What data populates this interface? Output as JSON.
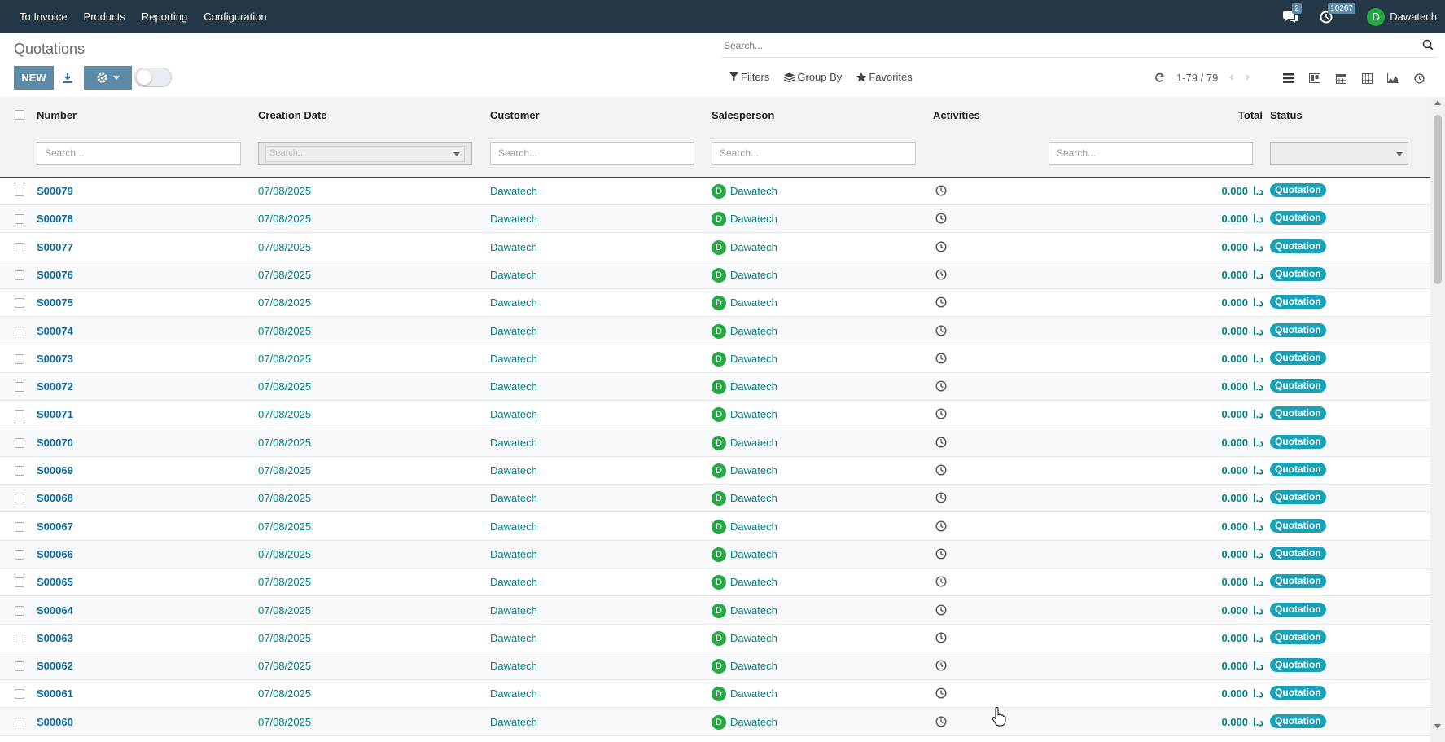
{
  "topbar": {
    "menu": [
      "To Invoice",
      "Products",
      "Reporting",
      "Configuration"
    ],
    "messages_count": "2",
    "activities_count": "10267",
    "user_initial": "D",
    "user_name": "Dawatech"
  },
  "control_panel": {
    "title": "Quotations",
    "new_label": "NEW",
    "search_placeholder": "Search...",
    "filters_label": "Filters",
    "group_by_label": "Group By",
    "favorites_label": "Favorites",
    "pager": "1-79 / 79",
    "views": [
      "list-view-icon",
      "kanban-view-icon",
      "calendar-view-icon",
      "pivot-view-icon",
      "graph-view-icon",
      "activity-view-icon"
    ]
  },
  "table": {
    "columns": {
      "number": "Number",
      "creation_date": "Creation Date",
      "customer": "Customer",
      "salesperson": "Salesperson",
      "activities": "Activities",
      "total": "Total",
      "status": "Status"
    },
    "filter_placeholder": "Search...",
    "currency": "د.ا",
    "rows": [
      {
        "number": "S00079",
        "date": "07/08/2025",
        "customer": "Dawatech",
        "salesperson": "Dawatech",
        "initial": "D",
        "total": "0.000",
        "status": "Quotation"
      },
      {
        "number": "S00078",
        "date": "07/08/2025",
        "customer": "Dawatech",
        "salesperson": "Dawatech",
        "initial": "D",
        "total": "0.000",
        "status": "Quotation"
      },
      {
        "number": "S00077",
        "date": "07/08/2025",
        "customer": "Dawatech",
        "salesperson": "Dawatech",
        "initial": "D",
        "total": "0.000",
        "status": "Quotation"
      },
      {
        "number": "S00076",
        "date": "07/08/2025",
        "customer": "Dawatech",
        "salesperson": "Dawatech",
        "initial": "D",
        "total": "0.000",
        "status": "Quotation"
      },
      {
        "number": "S00075",
        "date": "07/08/2025",
        "customer": "Dawatech",
        "salesperson": "Dawatech",
        "initial": "D",
        "total": "0.000",
        "status": "Quotation"
      },
      {
        "number": "S00074",
        "date": "07/08/2025",
        "customer": "Dawatech",
        "salesperson": "Dawatech",
        "initial": "D",
        "total": "0.000",
        "status": "Quotation"
      },
      {
        "number": "S00073",
        "date": "07/08/2025",
        "customer": "Dawatech",
        "salesperson": "Dawatech",
        "initial": "D",
        "total": "0.000",
        "status": "Quotation"
      },
      {
        "number": "S00072",
        "date": "07/08/2025",
        "customer": "Dawatech",
        "salesperson": "Dawatech",
        "initial": "D",
        "total": "0.000",
        "status": "Quotation"
      },
      {
        "number": "S00071",
        "date": "07/08/2025",
        "customer": "Dawatech",
        "salesperson": "Dawatech",
        "initial": "D",
        "total": "0.000",
        "status": "Quotation"
      },
      {
        "number": "S00070",
        "date": "07/08/2025",
        "customer": "Dawatech",
        "salesperson": "Dawatech",
        "initial": "D",
        "total": "0.000",
        "status": "Quotation"
      },
      {
        "number": "S00069",
        "date": "07/08/2025",
        "customer": "Dawatech",
        "salesperson": "Dawatech",
        "initial": "D",
        "total": "0.000",
        "status": "Quotation"
      },
      {
        "number": "S00068",
        "date": "07/08/2025",
        "customer": "Dawatech",
        "salesperson": "Dawatech",
        "initial": "D",
        "total": "0.000",
        "status": "Quotation"
      },
      {
        "number": "S00067",
        "date": "07/08/2025",
        "customer": "Dawatech",
        "salesperson": "Dawatech",
        "initial": "D",
        "total": "0.000",
        "status": "Quotation"
      },
      {
        "number": "S00066",
        "date": "07/08/2025",
        "customer": "Dawatech",
        "salesperson": "Dawatech",
        "initial": "D",
        "total": "0.000",
        "status": "Quotation"
      },
      {
        "number": "S00065",
        "date": "07/08/2025",
        "customer": "Dawatech",
        "salesperson": "Dawatech",
        "initial": "D",
        "total": "0.000",
        "status": "Quotation"
      },
      {
        "number": "S00064",
        "date": "07/08/2025",
        "customer": "Dawatech",
        "salesperson": "Dawatech",
        "initial": "D",
        "total": "0.000",
        "status": "Quotation"
      },
      {
        "number": "S00063",
        "date": "07/08/2025",
        "customer": "Dawatech",
        "salesperson": "Dawatech",
        "initial": "D",
        "total": "0.000",
        "status": "Quotation"
      },
      {
        "number": "S00062",
        "date": "07/08/2025",
        "customer": "Dawatech",
        "salesperson": "Dawatech",
        "initial": "D",
        "total": "0.000",
        "status": "Quotation"
      },
      {
        "number": "S00061",
        "date": "07/08/2025",
        "customer": "Dawatech",
        "salesperson": "Dawatech",
        "initial": "D",
        "total": "0.000",
        "status": "Quotation"
      },
      {
        "number": "S00060",
        "date": "07/08/2025",
        "customer": "Dawatech",
        "salesperson": "Dawatech",
        "initial": "D",
        "total": "0.000",
        "status": "Quotation"
      }
    ]
  }
}
